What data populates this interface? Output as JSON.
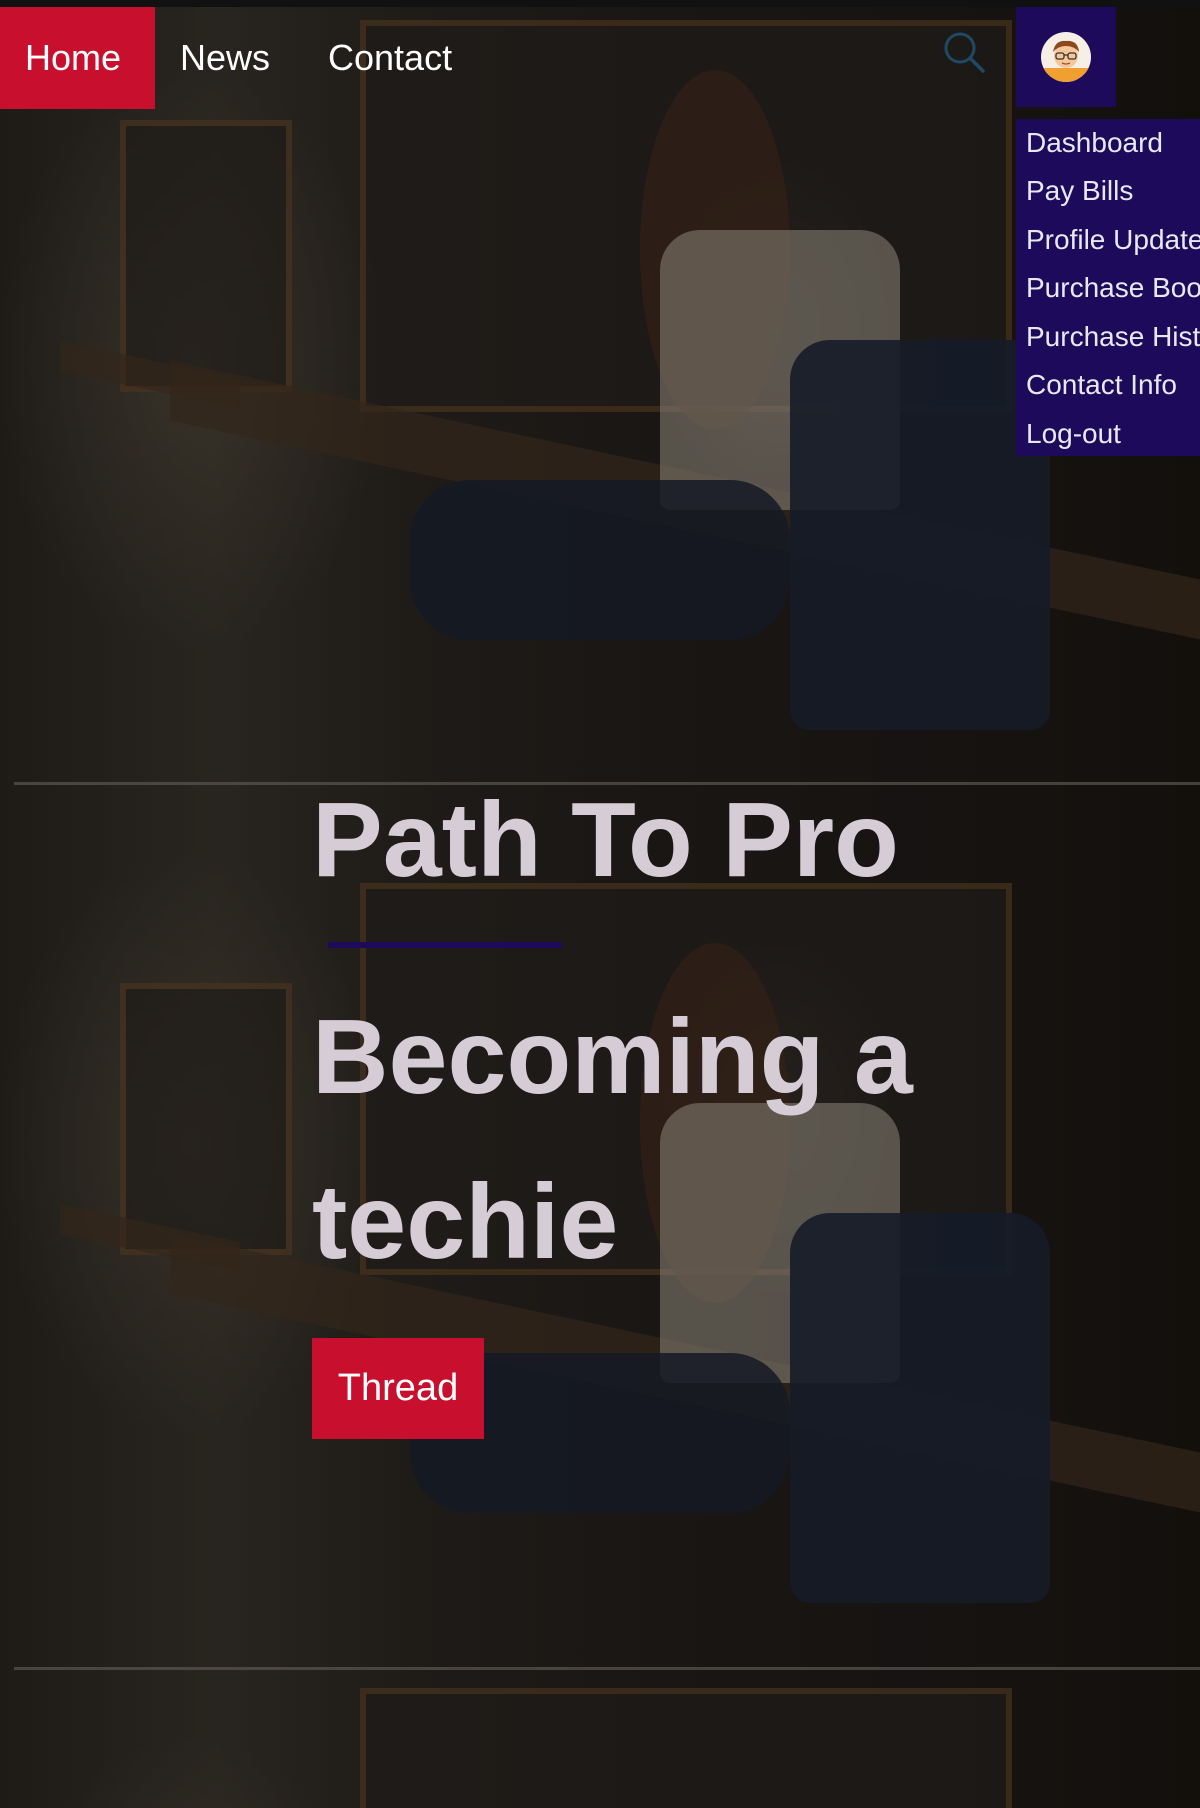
{
  "nav": {
    "items": [
      {
        "label": "Home",
        "active": true
      },
      {
        "label": "News"
      },
      {
        "label": "Contact"
      }
    ],
    "search_icon": "search-icon",
    "avatar_icon": "user-avatar-icon"
  },
  "dropdown": {
    "items": [
      {
        "label": "Dashboard"
      },
      {
        "label": "Pay Bills"
      },
      {
        "label": "Profile Update"
      },
      {
        "label": "Purchase Book"
      },
      {
        "label": "Purchase History"
      },
      {
        "label": "Contact Info"
      },
      {
        "label": "Log-out"
      }
    ]
  },
  "hero": {
    "title": "Path To Pro",
    "subtitle": "Becoming a techie",
    "button_label": "Thread"
  },
  "colors": {
    "accent_red": "#c8102e",
    "nav_purple": "#1e0a5a",
    "hero_text": "#d6ccd6"
  }
}
